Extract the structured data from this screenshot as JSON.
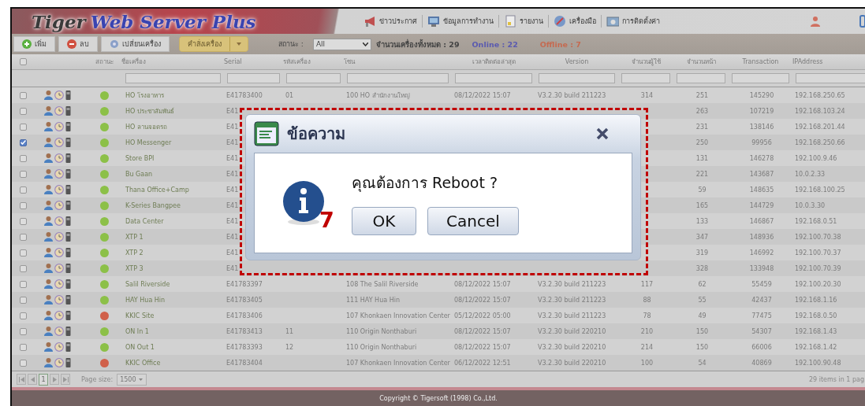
{
  "header": {
    "logo_parts": [
      {
        "text": "Tiger",
        "kind": "dark"
      },
      {
        "text": "Web Server Plus",
        "kind": "blue"
      }
    ],
    "nav": [
      {
        "label": "ข่าวประกาศ"
      },
      {
        "label": "ข้อมูลการทำงาน"
      },
      {
        "label": "รายงาน"
      },
      {
        "label": "เครื่องมือ"
      },
      {
        "label": "การติดตั้งค่า"
      }
    ]
  },
  "toolbar": {
    "buttons": [
      {
        "label": "เพิ่ม",
        "kind": "add"
      },
      {
        "label": "ลบ",
        "kind": "delete"
      },
      {
        "label": "เปลี่ยนเครื่อง",
        "kind": "swap"
      }
    ],
    "command_button": {
      "label": "คำสั่งเครื่อง"
    },
    "status_filter": {
      "label": "สถานะ :",
      "value": "All"
    },
    "total": "จำนวนเครื่องทั้งหมด : 29",
    "online": "Online : 22",
    "offline": "Offline : 7"
  },
  "table": {
    "select_all": {
      "checked": false
    },
    "columns": [
      "สถานะ",
      "ชื่อเครื่อง",
      "Serial",
      "รหัสเครื่อง",
      "โซน",
      "เวลาติดต่อล่าสุด",
      "Version",
      "จำนวนผู้ใช้",
      "จำนวนหน้า",
      "Transaction",
      "IPAddress"
    ],
    "rows": [
      {
        "checked": false,
        "online": true,
        "name": "HO โรงอาหาร",
        "serial": "E41783400",
        "code": "01",
        "zone": "100 HO สำนักงานใหญ่",
        "last_contact": "08/12/2022 15:07",
        "version": "V3.2.30 build 211223",
        "users": "314",
        "pages": "251",
        "transaction": "145290",
        "ip": "192.168.250.65"
      },
      {
        "checked": false,
        "online": true,
        "name": "HO ประชาสัมพันธ์",
        "serial": "E41",
        "pages": "263",
        "transaction": "107219",
        "ip": "192.168.103.24"
      },
      {
        "checked": false,
        "online": true,
        "name": "HO ลานจอดรถ",
        "serial": "E41",
        "pages": "231",
        "transaction": "138146",
        "ip": "192.168.201.44"
      },
      {
        "checked": true,
        "online": true,
        "name": "HO Messenger",
        "serial": "E41",
        "pages": "250",
        "transaction": "99956",
        "ip": "192.168.250.66"
      },
      {
        "checked": false,
        "online": true,
        "name": "Store BPI",
        "serial": "E41",
        "pages": "131",
        "transaction": "146278",
        "ip": "192.100.9.46"
      },
      {
        "checked": false,
        "online": true,
        "name": "Bu Gaan",
        "serial": "E41",
        "pages": "221",
        "transaction": "143687",
        "ip": "10.0.2.33"
      },
      {
        "checked": false,
        "online": true,
        "name": "Thana Office+Camp",
        "serial": "E41",
        "pages": "59",
        "transaction": "148635",
        "ip": "192.168.100.25"
      },
      {
        "checked": false,
        "online": true,
        "name": "K-Series Bangpee",
        "serial": "E41",
        "pages": "165",
        "transaction": "144729",
        "ip": "10.0.3.30"
      },
      {
        "checked": false,
        "online": true,
        "name": "Data Center",
        "serial": "E41",
        "pages": "133",
        "transaction": "146867",
        "ip": "192.168.0.51"
      },
      {
        "checked": false,
        "online": true,
        "name": "XTP 1",
        "serial": "E41",
        "pages": "347",
        "transaction": "148936",
        "ip": "192.100.70.38"
      },
      {
        "checked": false,
        "online": true,
        "name": "XTP 2",
        "serial": "E41",
        "pages": "319",
        "transaction": "146992",
        "ip": "192.100.70.37"
      },
      {
        "checked": false,
        "online": true,
        "name": "XTP 3",
        "serial": "E41",
        "pages": "328",
        "transaction": "133948",
        "ip": "192.100.70.39"
      },
      {
        "checked": false,
        "online": true,
        "name": "Salil Riverside",
        "serial": "E41783397",
        "zone": "108 The Salil Riverside",
        "last_contact": "08/12/2022 15:07",
        "version": "V3.2.30 build 211223",
        "users": "117",
        "pages": "62",
        "transaction": "55459",
        "ip": "192.100.20.30"
      },
      {
        "checked": false,
        "online": true,
        "name": "HAY Hua Hin",
        "serial": "E41783405",
        "zone": "111 HAY Hua Hin",
        "last_contact": "08/12/2022 15:07",
        "version": "V3.2.30 build 211223",
        "users": "88",
        "pages": "55",
        "transaction": "42437",
        "ip": "192.168.1.16"
      },
      {
        "checked": false,
        "online": false,
        "name": "KKIC Site",
        "serial": "E41783406",
        "zone": "107 Khonkaen Innovation Center",
        "last_contact": "05/12/2022 05:00",
        "version": "V3.2.30 build 211223",
        "users": "78",
        "pages": "49",
        "transaction": "77475",
        "ip": "192.168.0.50"
      },
      {
        "checked": false,
        "online": true,
        "name": "ON In 1",
        "serial": "E41783413",
        "code": "11",
        "zone": "110 Origin Nonthaburi",
        "last_contact": "08/12/2022 15:07",
        "version": "V3.2.30 build 220210",
        "users": "210",
        "pages": "150",
        "transaction": "54307",
        "ip": "192.168.1.43"
      },
      {
        "checked": false,
        "online": true,
        "name": "ON Out 1",
        "serial": "E41783393",
        "code": "12",
        "zone": "110 Origin Nonthaburi",
        "last_contact": "08/12/2022 15:07",
        "version": "V3.2.30 build 220210",
        "users": "214",
        "pages": "150",
        "transaction": "66006",
        "ip": "192.168.1.42"
      },
      {
        "checked": false,
        "online": false,
        "name": "KKIC Office",
        "serial": "E41783404",
        "zone": "107 Khonkaen Innovation Center",
        "last_contact": "06/12/2022 12:51",
        "version": "V3.2.30 build 220210",
        "users": "100",
        "pages": "54",
        "transaction": "40869",
        "ip": "192.100.90.48"
      }
    ]
  },
  "pager": {
    "page": "1",
    "page_size_label": "Page size:",
    "page_size": "1500",
    "summary": "29 items in 1 pag"
  },
  "footer": "Copyright © Tigersoft (1998) Co.,Ltd.",
  "dialog": {
    "title": "ข้อความ",
    "message": "คุณต้องการ Reboot ?",
    "buttons": [
      "OK",
      "Cancel"
    ]
  },
  "annotation": {
    "step": "7"
  }
}
